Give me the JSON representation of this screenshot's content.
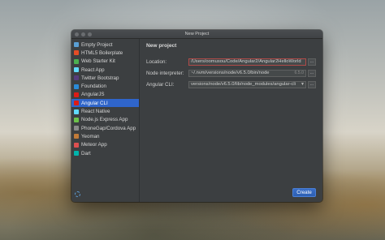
{
  "window": {
    "title": "New Project"
  },
  "sidebar": {
    "items": [
      {
        "label": "Empty Project",
        "icon": "empty-project-icon",
        "color": "#5a9fd4",
        "selected": false
      },
      {
        "label": "HTML5 Boilerplate",
        "icon": "html5-icon",
        "color": "#e44d26",
        "selected": false
      },
      {
        "label": "Web Starter Kit",
        "icon": "web-starter-kit-icon",
        "color": "#4caf50",
        "selected": false
      },
      {
        "label": "React App",
        "icon": "react-icon",
        "color": "#61dafb",
        "selected": false
      },
      {
        "label": "Twitter Bootstrap",
        "icon": "bootstrap-icon",
        "color": "#563d7c",
        "selected": false
      },
      {
        "label": "Foundation",
        "icon": "foundation-icon",
        "color": "#2a8bd8",
        "selected": false
      },
      {
        "label": "AngularJS",
        "icon": "angularjs-icon",
        "color": "#dd1b16",
        "selected": false
      },
      {
        "label": "Angular CLI",
        "icon": "angular-cli-icon",
        "color": "#dd1b16",
        "selected": true
      },
      {
        "label": "React Native",
        "icon": "react-native-icon",
        "color": "#61dafb",
        "selected": false
      },
      {
        "label": "Node.js Express App",
        "icon": "nodejs-icon",
        "color": "#6cc24a",
        "selected": false
      },
      {
        "label": "PhoneGap/Cordova App",
        "icon": "phonegap-icon",
        "color": "#8a8a8a",
        "selected": false
      },
      {
        "label": "Yeoman",
        "icon": "yeoman-icon",
        "color": "#c27b38",
        "selected": false
      },
      {
        "label": "Meteor App",
        "icon": "meteor-icon",
        "color": "#de4f4f",
        "selected": false
      },
      {
        "label": "Dart",
        "icon": "dart-icon",
        "color": "#00b4ab",
        "selected": false
      }
    ]
  },
  "main": {
    "heading": "New project",
    "location_label": "Location:",
    "location_value": "/Users/oomusou/Code/Angular2/Angular2HelloWorld",
    "interpreter_label": "Node interpreter:",
    "interpreter_value": "~/.nvm/versions/node/v6.5.0/bin/node",
    "interpreter_version": "6.5.0",
    "cli_label": "Angular CLI:",
    "cli_value": "versions/node/v6.5.0/lib/node_modules/angular-cli",
    "more_button": "...",
    "create_button": "Create"
  }
}
